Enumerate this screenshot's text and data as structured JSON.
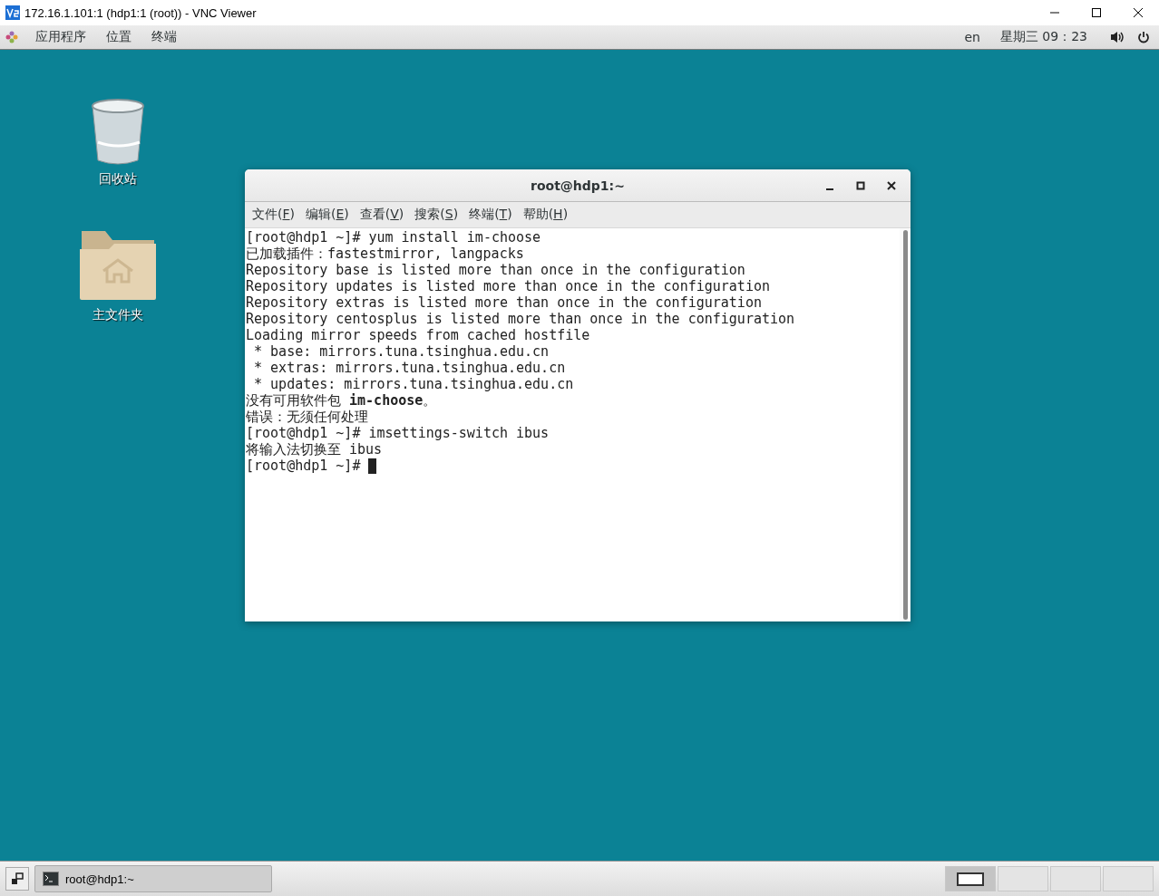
{
  "vnc_window": {
    "title": "172.16.1.101:1 (hdp1:1 (root)) - VNC Viewer"
  },
  "top_bar": {
    "menus": [
      "应用程序",
      "位置",
      "终端"
    ],
    "input_method": "en",
    "clock": "星期三 09：23"
  },
  "desktop_icons": [
    {
      "kind": "trash",
      "label": "回收站"
    },
    {
      "kind": "folder",
      "label": "主文件夹"
    }
  ],
  "terminal": {
    "title": "root@hdp1:~",
    "menus": [
      "文件(F)",
      "编辑(E)",
      "查看(V)",
      "搜索(S)",
      "终端(T)",
      "帮助(H)"
    ],
    "lines": [
      "[root@hdp1 ~]# yum install im-choose",
      "已加载插件：fastestmirror, langpacks",
      "Repository base is listed more than once in the configuration",
      "Repository updates is listed more than once in the configuration",
      "Repository extras is listed more than once in the configuration",
      "Repository centosplus is listed more than once in the configuration",
      "Loading mirror speeds from cached hostfile",
      " * base: mirrors.tuna.tsinghua.edu.cn",
      " * extras: mirrors.tuna.tsinghua.edu.cn",
      " * updates: mirrors.tuna.tsinghua.edu.cn",
      "没有可用软件包 **im-choose**。",
      "错误：无须任何处理",
      "[root@hdp1 ~]# imsettings-switch ibus",
      "将输入法切换至 ibus",
      "[root@hdp1 ~]# "
    ],
    "cursor": true
  },
  "taskbar": {
    "tasks": [
      "root@hdp1:~"
    ]
  }
}
